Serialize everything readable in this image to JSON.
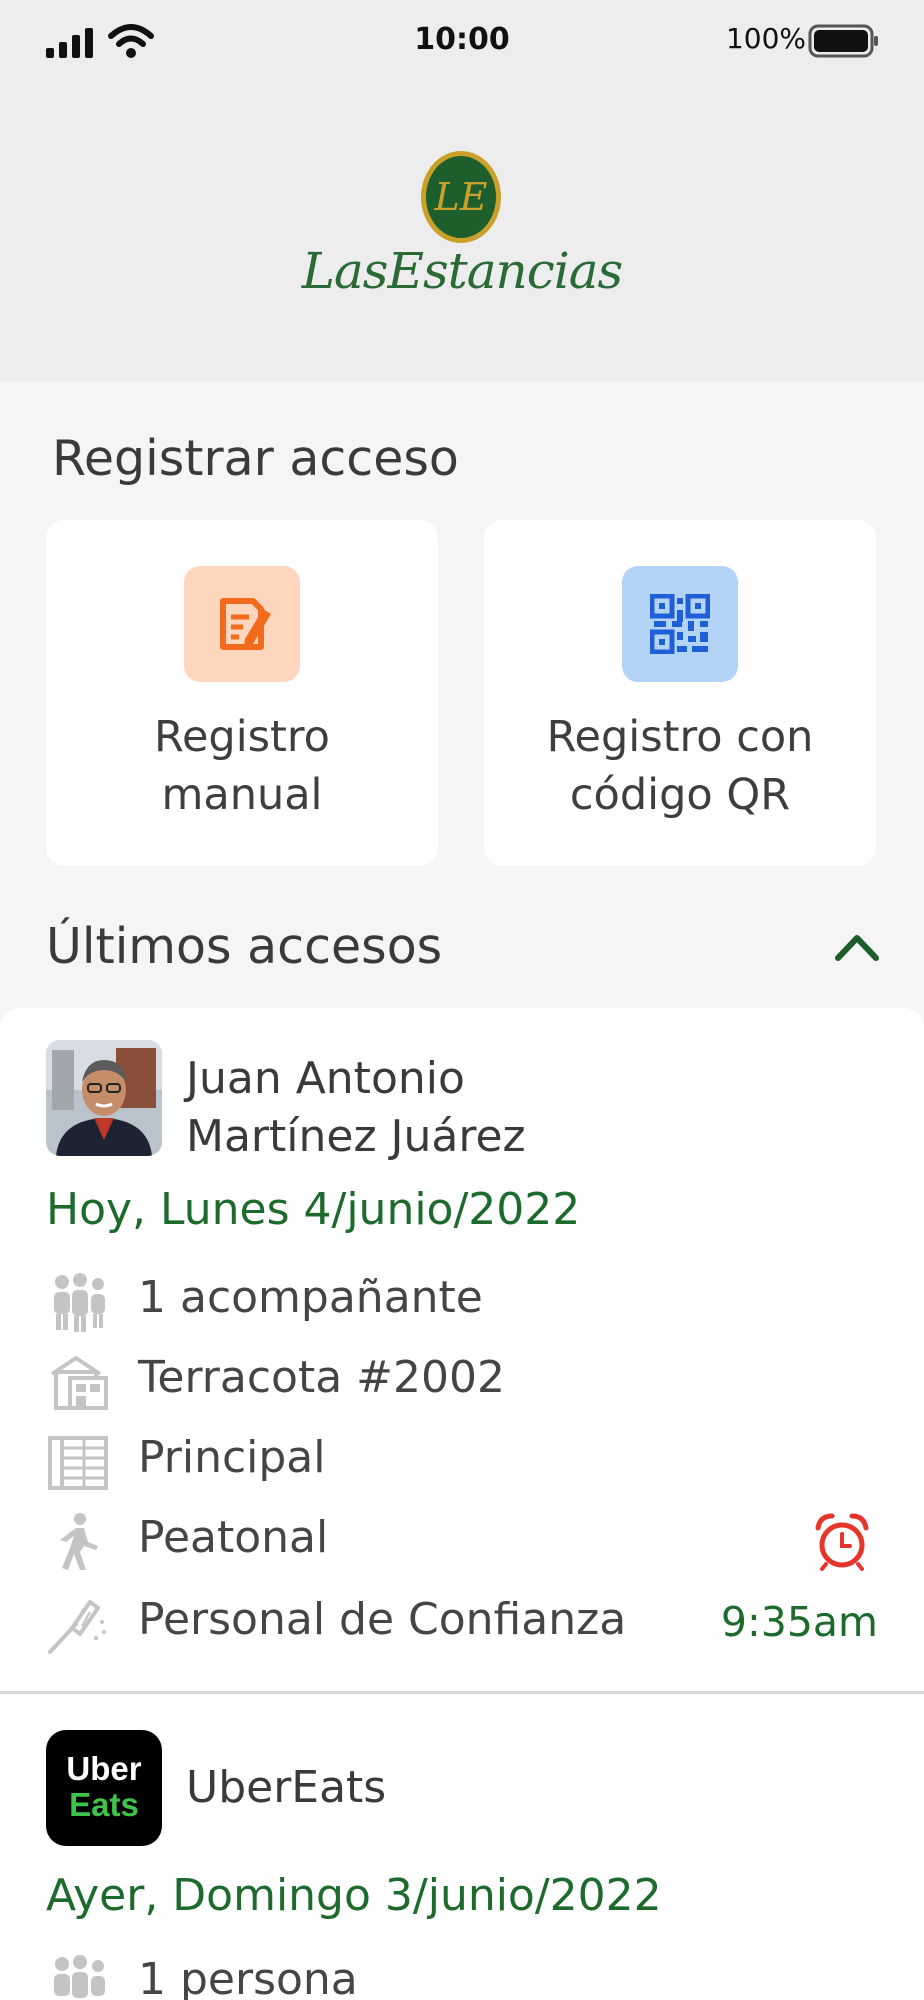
{
  "status_bar": {
    "time": "10:00",
    "battery_percent": "100%"
  },
  "header": {
    "logo_monogram": "LE",
    "logo_text": "LasEstancias",
    "brand_color": "#1d6b2c",
    "logo_gold": "#c9a02a"
  },
  "register": {
    "title": "Registrar acceso",
    "manual_label": "Registro\nmanual",
    "qr_label": "Registro con\ncódigo QR",
    "manual_icon": "edit-document-icon",
    "qr_icon": "qr-code-icon"
  },
  "recent": {
    "title": "Últimos accesos",
    "toggle_icon": "chevron-up-icon",
    "entries": [
      {
        "name": "Juan Antonio\nMartínez Juárez",
        "date": "Hoy, Lunes 4/junio/2022",
        "companions": "1 acompañante",
        "address": "Terracota #2002",
        "gate": "Principal",
        "mode": "Peatonal",
        "category": "Personal de Confianza",
        "time": "9:35am",
        "alarm_color": "#e8352c"
      },
      {
        "name": "UberEats",
        "logo_line1": "Uber",
        "logo_line2": "Eats",
        "date": "Ayer, Domingo 3/junio/2022",
        "companions": "1 persona"
      }
    ]
  }
}
